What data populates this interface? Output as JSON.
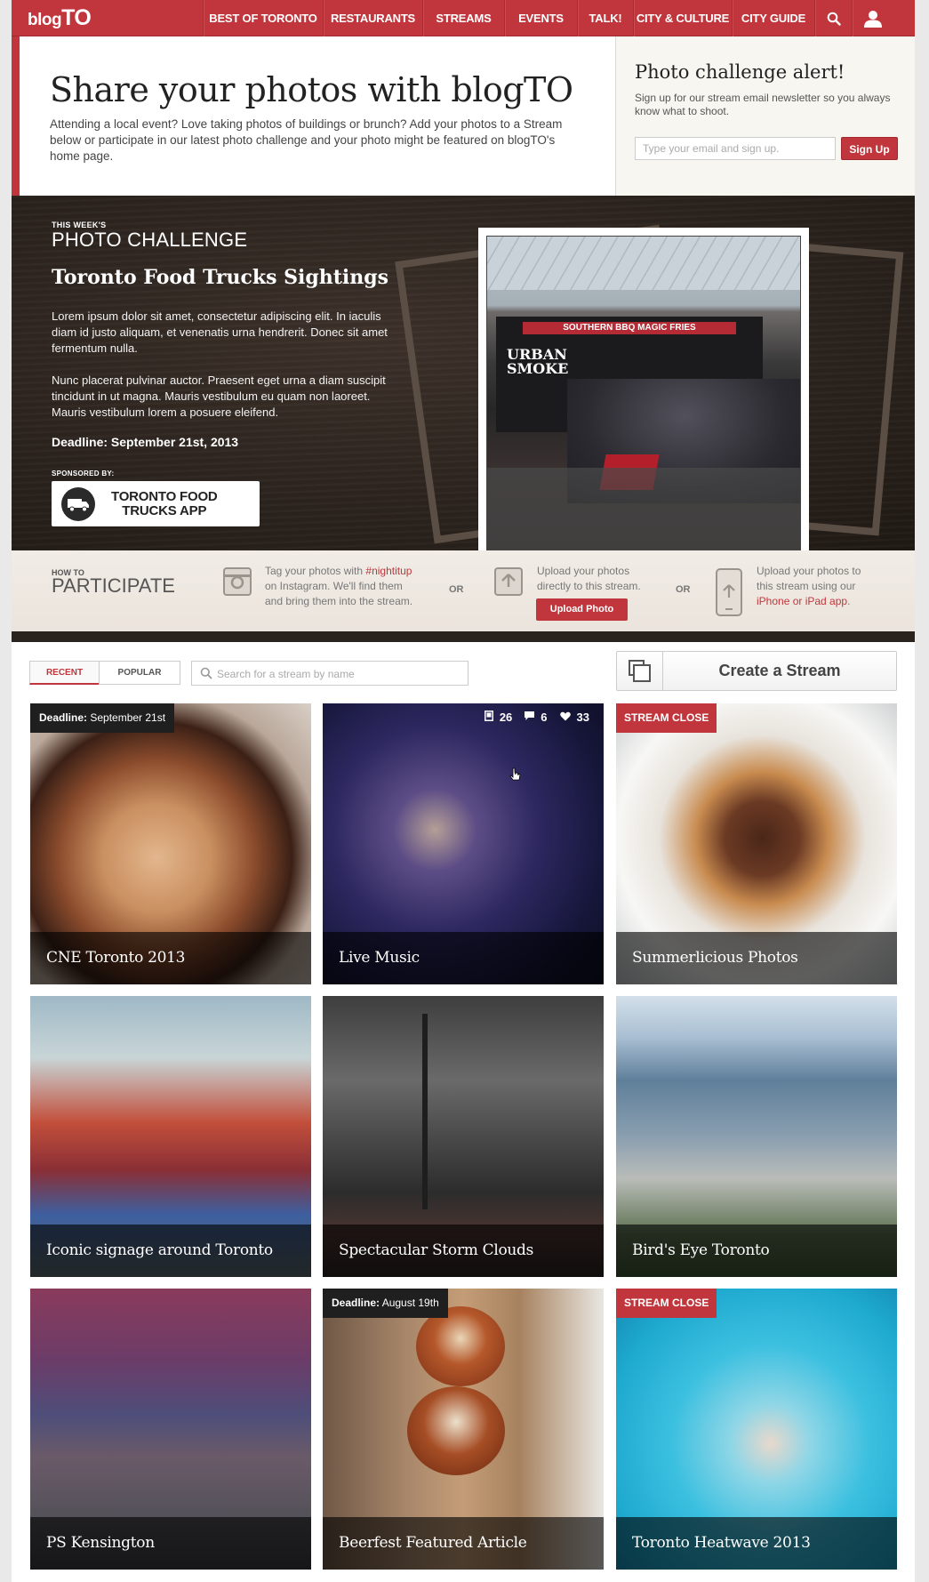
{
  "nav": {
    "logo_a": "blog",
    "logo_b": "TO",
    "items": [
      {
        "label": "BEST OF TORONTO"
      },
      {
        "label": "RESTAURANTS"
      },
      {
        "label": "STREAMS"
      },
      {
        "label": "EVENTS"
      },
      {
        "label": "TALK!"
      },
      {
        "label": "CITY & CULTURE"
      },
      {
        "label": "CITY GUIDE"
      }
    ],
    "icons": [
      "search-icon",
      "user-icon"
    ],
    "brand_color": "#c0363c"
  },
  "hero": {
    "title": "Share your photos with blogTO",
    "description": "Attending a local event? Love taking photos of buildings or brunch? Add your photos to a Stream below or participate in our latest photo challenge and your photo might be featured on blogTO's home page."
  },
  "alert": {
    "title": "Photo challenge alert!",
    "description": "Sign up for our stream email newsletter so you always know what to shoot.",
    "email_placeholder": "Type your email and sign up.",
    "signup_label": "Sign Up"
  },
  "challenge": {
    "kicker": "THIS WEEK'S",
    "heading": "PHOTO CHALLENGE",
    "title": "Toronto Food Trucks Sightings",
    "para1": "Lorem ipsum dolor sit amet, consectetur adipiscing elit. In iaculis diam id justo aliquam, et venenatis urna hendrerit. Donec sit amet fermentum nulla.",
    "para2": "Nunc placerat pulvinar auctor. Praesent eget urna a diam suscipit tincidunt in ut magna. Mauris vestibulum eu quam non laoreet. Mauris vestibulum lorem a posuere eleifend.",
    "deadline": "Deadline: September 21st, 2013",
    "sponsored_by": "SPONSORED BY:",
    "sponsor_line1": "TORONTO FOOD",
    "sponsor_line2": "TRUCKS APP",
    "photo_sign": "SOUTHERN BBQ MAGIC FRIES",
    "photo_truck_a": "URBAN",
    "photo_truck_b": "SMOKE"
  },
  "participate": {
    "kicker": "HOW TO",
    "heading": "PARTICIPATE",
    "step1_a": "Tag your photos with ",
    "step1_tag": "#nightitup",
    "step1_b": "on Instagram. We'll find them",
    "step1_c": "and bring them into the stream.",
    "or": "OR",
    "step2_a": "Upload your photos",
    "step2_b": "directly to this stream.",
    "upload_label": "Upload Photo",
    "step3_a": "Upload your photos to",
    "step3_b": "this stream using our",
    "step3_link": "iPhone or iPad app",
    "step3_end": "."
  },
  "toolbar": {
    "tab_recent": "RECENT",
    "tab_popular": "POPULAR",
    "search_placeholder": "Search for a stream by name",
    "create_label": "Create a Stream"
  },
  "streams": [
    {
      "title": "CNE Toronto 2013",
      "badge_bold": "Deadline:",
      "badge_text": " September 21st"
    },
    {
      "title": "Live Music",
      "stats": {
        "photos": "26",
        "comments": "6",
        "likes": "33"
      }
    },
    {
      "title": "Summerlicious Photos",
      "badge": "STREAM CLOSE"
    },
    {
      "title": "Iconic signage around Toronto"
    },
    {
      "title": "Spectacular Storm Clouds"
    },
    {
      "title": "Bird's Eye Toronto"
    },
    {
      "title": "PS Kensington"
    },
    {
      "title": "Beerfest Featured Article",
      "badge_bold": "Deadline:",
      "badge_text": " August 19th"
    },
    {
      "title": "Toronto Heatwave 2013",
      "badge": "STREAM CLOSE"
    }
  ]
}
